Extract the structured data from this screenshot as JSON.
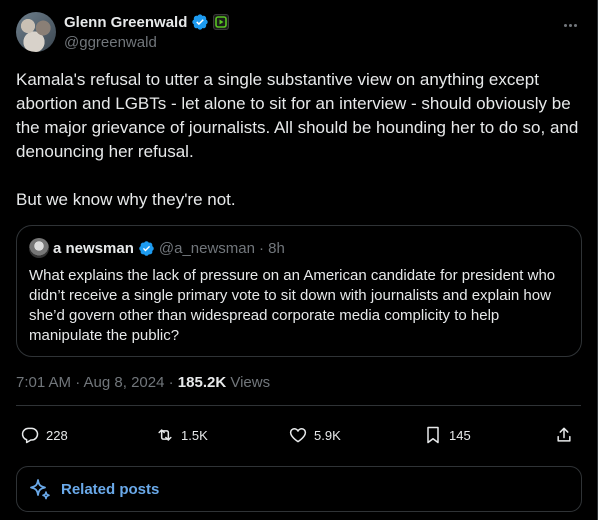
{
  "author": {
    "name": "Glenn Greenwald",
    "handle": "@ggreenwald"
  },
  "tweet": {
    "text": "Kamala's refusal to utter a single substantive view on anything except abortion and LGBTs - let alone to sit for an interview - should obviously be the major grievance of journalists. All should be hounding her to do so, and denouncing her refusal.\n\nBut we know why they're not."
  },
  "quote": {
    "name": "a newsman",
    "handle": "@a_newsman",
    "time": "· 8h",
    "text": "What explains the lack of pressure on an American candidate for president who didn’t receive a single primary vote to sit down with journalists and explain how she’d govern other than widespread corporate media complicity to help manipulate the public?"
  },
  "meta": {
    "time": "7:01 AM · Aug 8, 2024",
    "sep": " · ",
    "views_count": "185.2K",
    "views_label": " Views"
  },
  "actions": {
    "replies": "228",
    "reposts": "1.5K",
    "likes": "5.9K",
    "bookmarks": "145"
  },
  "related": {
    "label": "Related posts"
  },
  "colors": {
    "background": "#000000",
    "accent": "#1d9bf0",
    "text": "#e7e9ea",
    "muted": "#71767b",
    "border": "#2f3336"
  },
  "icons": [
    "verified-icon",
    "subscriber-badge-icon",
    "more-icon",
    "reply-icon",
    "repost-icon",
    "like-icon",
    "bookmark-icon",
    "share-icon",
    "sparkle-icon"
  ]
}
